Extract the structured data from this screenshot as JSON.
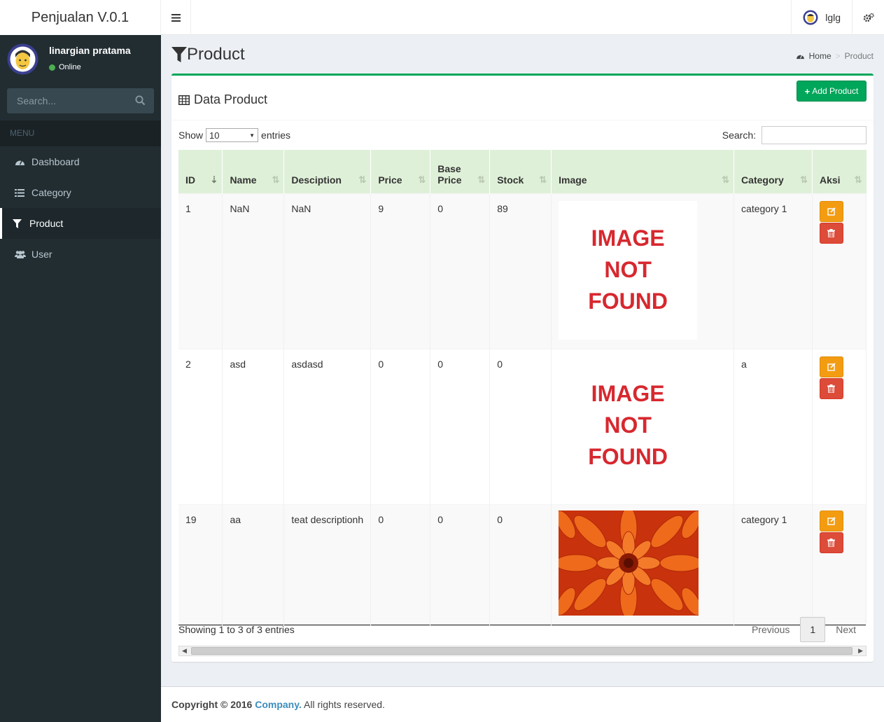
{
  "app": {
    "title": "Penjualan V.0.1"
  },
  "topbar": {
    "username": "lglg"
  },
  "sidebar": {
    "user_name": "linargian pratama",
    "status": "Online",
    "search_placeholder": "Search...",
    "menu_header": "MENU",
    "items": [
      {
        "label": "Dashboard",
        "icon": "dashboard-icon"
      },
      {
        "label": "Category",
        "icon": "list-icon"
      },
      {
        "label": "Product",
        "icon": "filter-icon",
        "active": true
      },
      {
        "label": "User",
        "icon": "users-icon"
      }
    ]
  },
  "page": {
    "title": "Product",
    "breadcrumb": {
      "home": "Home",
      "current": "Product"
    }
  },
  "box": {
    "title": "Data Product",
    "add_button": "Add Product",
    "show_label": "Show",
    "entries_value": "10",
    "entries_label": "entries",
    "search_label": "Search:",
    "search_value": "",
    "info": "Showing 1 to 3 of 3 entries",
    "pagination": {
      "previous": "Previous",
      "page": "1",
      "next": "Next"
    }
  },
  "table": {
    "headers": [
      "ID",
      "Name",
      "Desciption",
      "Price",
      "Base",
      "Price",
      "Stock",
      "Image",
      "Category",
      "Aksi"
    ],
    "header_base_price": [
      "Base",
      "Price"
    ],
    "rows": [
      {
        "id": "1",
        "name": "NaN",
        "description": "NaN",
        "price": "9",
        "base_price": "0",
        "stock": "89",
        "image_text": [
          "IMAGE",
          "NOT",
          "FOUND"
        ],
        "category": "category 1"
      },
      {
        "id": "2",
        "name": "asd",
        "description": "asdasd",
        "price": "0",
        "base_price": "0",
        "stock": "0",
        "image_text": [
          "IMAGE",
          "NOT",
          "FOUND"
        ],
        "category": "a"
      },
      {
        "id": "19",
        "name": "aa",
        "description": "teat descriptionh",
        "price": "0",
        "base_price": "0",
        "stock": "0",
        "image_text": null,
        "category": "category 1"
      }
    ]
  },
  "footer": {
    "copyright": "Copyright © 2016",
    "company": "Company.",
    "rights": "All rights reserved."
  },
  "colors": {
    "sidebar_bg": "#222d32",
    "box_accent": "#00a65a",
    "edit": "#f39c12",
    "delete": "#dd4b39",
    "table_header": "#dff0d8",
    "not_found": "#d7282f"
  }
}
